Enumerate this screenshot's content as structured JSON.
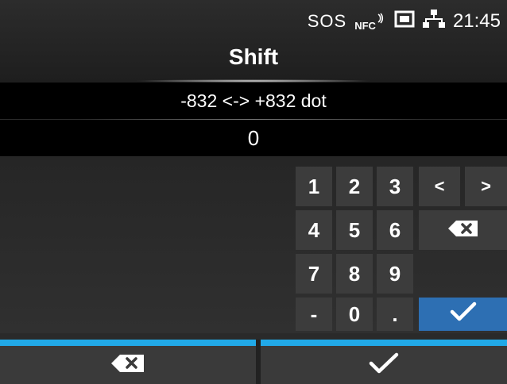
{
  "status_bar": {
    "sos": "SOS",
    "nfc": "NFC",
    "time": "21:45",
    "icons": [
      "nfc-icon",
      "sd-card-icon",
      "network-icon"
    ]
  },
  "title": "Shift",
  "range": "-832 <-> +832 dot",
  "value": "0",
  "keypad": {
    "keys": [
      "1",
      "2",
      "3",
      "4",
      "5",
      "6",
      "7",
      "8",
      "9",
      "-",
      "0",
      "."
    ],
    "left_arrow": "<",
    "right_arrow": ">",
    "backspace_icon": "backspace-icon",
    "ok_icon": "checkmark-icon"
  },
  "softkeys": {
    "left_icon": "backspace-icon",
    "right_icon": "checkmark-icon"
  },
  "colors": {
    "accent_line": "#21a9e8",
    "ok_key": "#2d6fb3"
  }
}
